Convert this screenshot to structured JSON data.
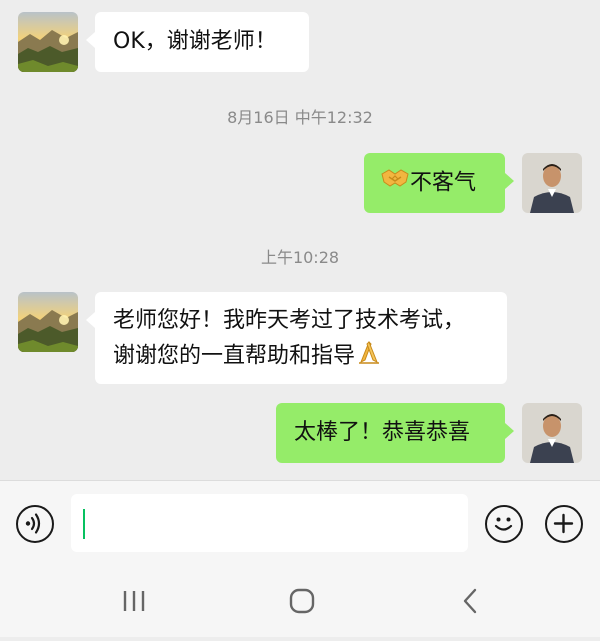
{
  "messages": [
    {
      "side": "in",
      "text": "OK，谢谢老师！"
    },
    {
      "side": "time",
      "text": "8月16日 中午12:32"
    },
    {
      "side": "out",
      "emoji": "handshake-emoji",
      "text": "不客气"
    },
    {
      "side": "time",
      "text": "上午10:28"
    },
    {
      "side": "in",
      "lines": [
        "老师您好！我昨天考过了技术考试，",
        "谢谢您的一直帮助和指导"
      ],
      "emoji": "pray-hands-emoji"
    },
    {
      "side": "out",
      "text": "太棒了！恭喜恭喜"
    }
  ],
  "input": {
    "value": "",
    "placeholder": ""
  },
  "icons": {
    "voice": "voice-toggle-icon",
    "emoji": "smiley-icon",
    "plus": "plus-icon",
    "recents": "recents-icon",
    "home": "home-icon",
    "back": "back-icon"
  },
  "colors": {
    "outgoing_bubble": "#95ec69",
    "incoming_bubble": "#ffffff",
    "background": "#ededed",
    "cursor": "#07c160"
  }
}
